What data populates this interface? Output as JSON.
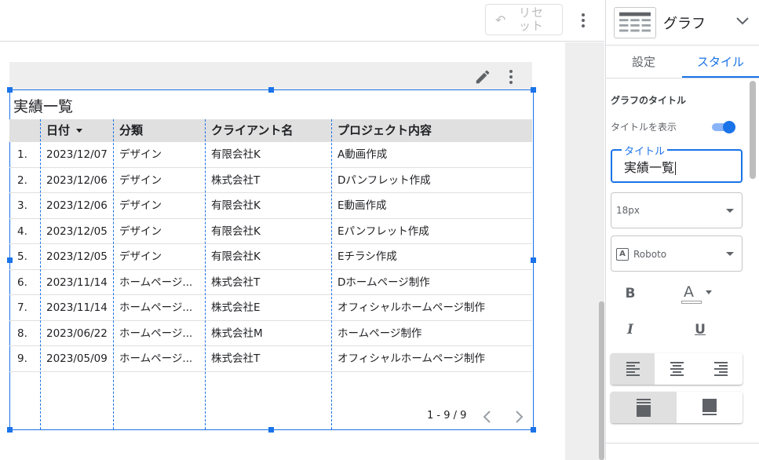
{
  "toolbar": {
    "reset_label": "リセット"
  },
  "chart": {
    "title": "実績一覧",
    "columns": [
      "",
      "日付",
      "分類",
      "クライアント名",
      "プロジェクト内容"
    ],
    "rows": [
      [
        "1.",
        "2023/12/07",
        "デザイン",
        "有限会社K",
        "A動画作成"
      ],
      [
        "2.",
        "2023/12/06",
        "デザイン",
        "株式会社T",
        "Dパンフレット作成"
      ],
      [
        "3.",
        "2023/12/06",
        "デザイン",
        "有限会社K",
        "E動画作成"
      ],
      [
        "4.",
        "2023/12/05",
        "デザイン",
        "有限会社K",
        "Eパンフレット作成"
      ],
      [
        "5.",
        "2023/12/05",
        "デザイン",
        "有限会社K",
        "Eチラシ作成"
      ],
      [
        "6.",
        "2023/11/14",
        "ホームページ...",
        "株式会社T",
        "Dホームページ制作"
      ],
      [
        "7.",
        "2023/11/14",
        "ホームページ...",
        "株式会社E",
        "オフィシャルホームページ制作"
      ],
      [
        "8.",
        "2023/06/22",
        "ホームページ...",
        "株式会社M",
        "ホームページ制作"
      ],
      [
        "9.",
        "2023/05/09",
        "ホームページ...",
        "株式会社T",
        "オフィシャルホームページ制作"
      ]
    ],
    "pagination": "1 - 9 / 9"
  },
  "panel": {
    "chart_type": "グラフ",
    "tabs": [
      {
        "label": "設定",
        "active": false
      },
      {
        "label": "スタイル",
        "active": true
      }
    ],
    "section_title": "グラフのタイトル",
    "show_title_label": "タイトルを表示",
    "show_title_on": true,
    "title_field_label": "タイトル",
    "title_field_value": "実績一覧",
    "font_size": "18px",
    "font_family": "Roboto",
    "bold_label": "B",
    "color_label": "A",
    "italic_label": "I",
    "underline_label": "U"
  },
  "colors": {
    "accent": "#1a73e8",
    "header_bg": "#e0e0e0",
    "toolbar_bg": "#eeeeee"
  },
  "icons": [
    "undo-icon",
    "more-vert-icon",
    "edit-icon",
    "chevron-left-icon",
    "chevron-right-icon",
    "table-chart-icon",
    "chevron-down-icon",
    "text-color-icon",
    "align-left-icon",
    "align-center-icon",
    "align-right-icon",
    "background-fill-icon",
    "border-fill-icon"
  ]
}
